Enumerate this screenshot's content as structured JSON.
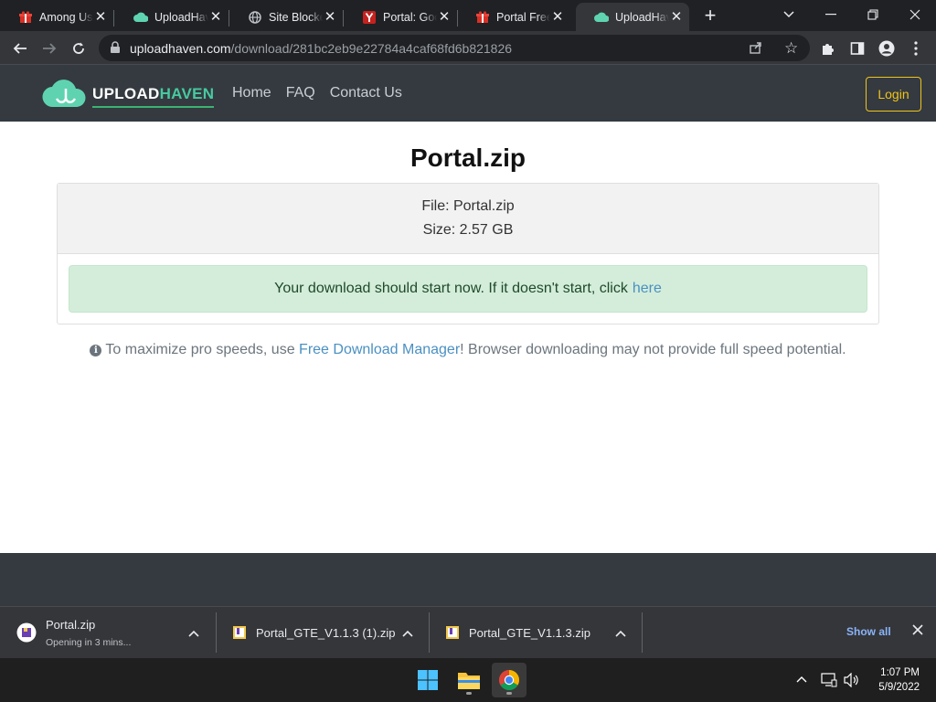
{
  "browser": {
    "tabs": [
      {
        "title": "Among Us | Free",
        "favicon": "red-gift-icon"
      },
      {
        "title": "UploadHaven",
        "favicon": "uploadhaven-cloud-icon"
      },
      {
        "title": "Site Blocked",
        "favicon": "globe-icon"
      },
      {
        "title": "Portal: Google",
        "favicon": "y-favicon-icon"
      },
      {
        "title": "Portal Free",
        "favicon": "red-gift-icon"
      },
      {
        "title": "UploadHaven",
        "favicon": "uploadhaven-cloud-icon"
      }
    ],
    "active_tab": 5,
    "close_glyph": "✕",
    "url_host": "uploadhaven.com",
    "url_path": "/download/281bc2eb9e22784a4caf68fd6b821826"
  },
  "site": {
    "logo_text_left": "UPLOAD",
    "logo_text_right": "HAVEN",
    "nav": [
      "Home",
      "FAQ",
      "Contact Us"
    ],
    "login_label": "Login",
    "brand_color": "#48c9a0",
    "login_color": "#f0c419"
  },
  "download": {
    "title": "Portal.zip",
    "file_line": "File: Portal.zip",
    "size_line": "Size: 2.57 GB",
    "alert_text": "Your download should start now. If it doesn't start, click",
    "alert_link": "here",
    "tip_text_before": "To maximize pro speeds, use",
    "tip_link": "Free Download Manager",
    "tip_text_after": "! Browser downloading may not provide full speed potential."
  },
  "shelf": {
    "items": [
      {
        "name": "Portal.zip",
        "status": "Opening in 3 mins..."
      },
      {
        "name": "Portal_GTE_V1.1.3 (1).zip",
        "status": ""
      },
      {
        "name": "Portal_GTE_V1.1.3.zip",
        "status": ""
      }
    ],
    "show_all": "Show all"
  },
  "taskbar": {
    "time": "1:07 PM",
    "date": "5/9/2022"
  }
}
